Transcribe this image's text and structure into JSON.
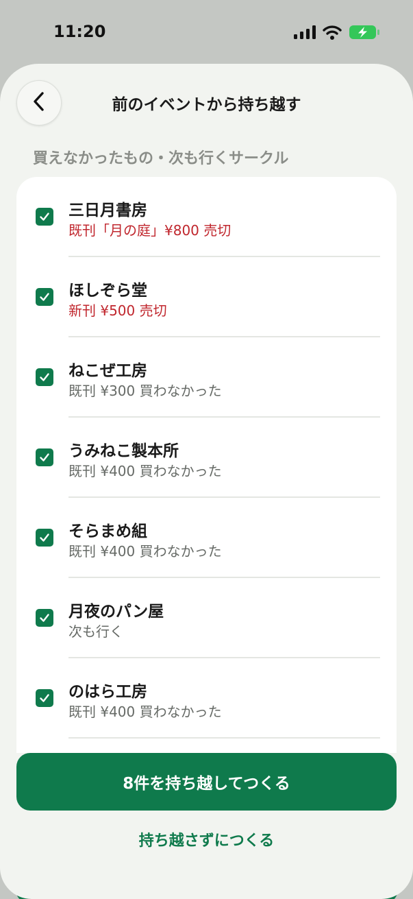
{
  "status_bar": {
    "time": "11:20",
    "icons": [
      "signal-icon",
      "wifi-icon",
      "battery-charging-icon"
    ],
    "battery_color": "#34c759"
  },
  "header": {
    "title": "前のイベントから持ち越す",
    "back_icon": "chevron-left-icon"
  },
  "section": {
    "label": "買えなかったもの・次も行くサークル"
  },
  "items": [
    {
      "title": "三日月書房",
      "subtitle": "既刊「月の庭」¥800 売切",
      "status": "sold-out",
      "checked": true
    },
    {
      "title": "ほしぞら堂",
      "subtitle": "新刊 ¥500 売切",
      "status": "sold-out",
      "checked": true
    },
    {
      "title": "ねこぜ工房",
      "subtitle": "既刊 ¥300 買わなかった",
      "status": "not-bought",
      "checked": true
    },
    {
      "title": "うみねこ製本所",
      "subtitle": "既刊 ¥400 買わなかった",
      "status": "not-bought",
      "checked": true
    },
    {
      "title": "そらまめ組",
      "subtitle": "既刊 ¥400 買わなかった",
      "status": "not-bought",
      "checked": true
    },
    {
      "title": "月夜のパン屋",
      "subtitle": "次も行く",
      "status": "next",
      "checked": true
    },
    {
      "title": "のはら工房",
      "subtitle": "既刊 ¥400 買わなかった",
      "status": "not-bought",
      "checked": true
    }
  ],
  "actions": {
    "primary_label": "8件を持ち越してつくる",
    "secondary_label": "持ち越さずにつくる"
  },
  "colors": {
    "accent": "#0f7a4c",
    "sold_out": "#c0262d",
    "sheet_bg": "#f2f4f0"
  }
}
